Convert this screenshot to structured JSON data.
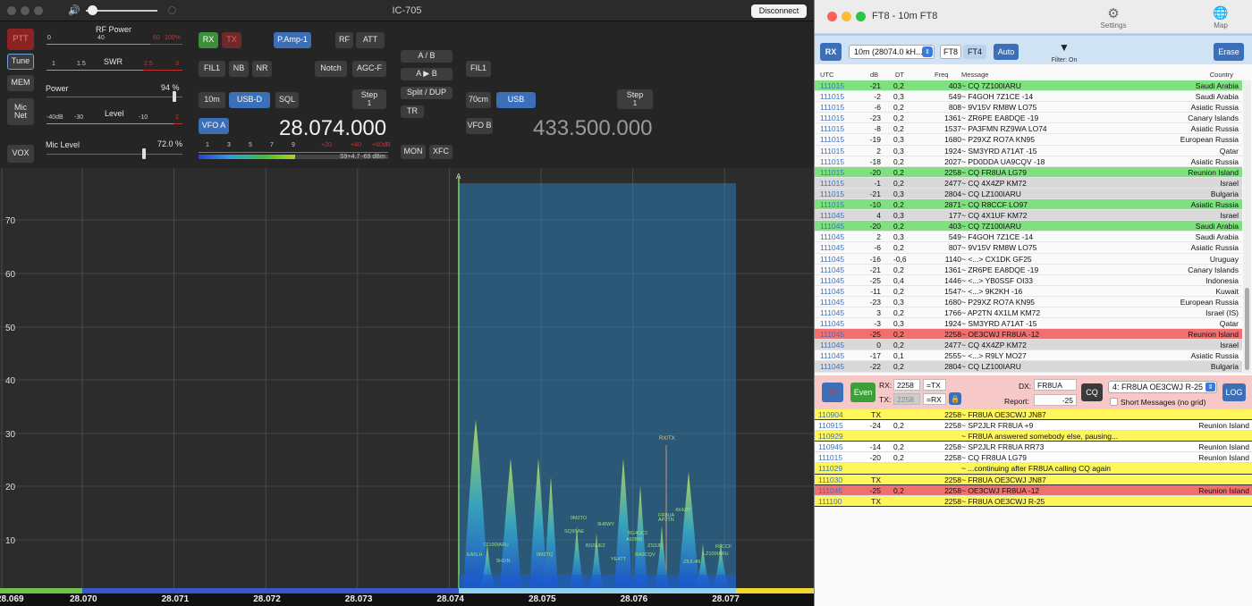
{
  "radio": {
    "title": "IC-705",
    "disconnect_label": "Disconnect",
    "left_buttons": {
      "ptt": "PTT",
      "tune": "Tune",
      "mem": "MEM",
      "mic_net": "Mic\nNet",
      "vox": "VOX"
    },
    "rf_power": {
      "label": "RF Power",
      "ticks": [
        "0",
        "40",
        "60",
        "100%"
      ]
    },
    "swr": {
      "label": "SWR",
      "ticks": [
        "1",
        "1.5",
        "2.5",
        "3"
      ]
    },
    "power": {
      "label": "Power",
      "value": "94 %",
      "level": 0.94
    },
    "level": {
      "label": "Level",
      "ticks": [
        "-40dB",
        "-30",
        "-10",
        "2"
      ]
    },
    "mic_level": {
      "label": "Mic Level",
      "value": "72.0 %",
      "level": 0.72
    },
    "buttons": {
      "rx": "RX",
      "tx": "TX",
      "pamp": "P.Amp-1",
      "rf": "RF",
      "att": "ATT",
      "fil1_a": "FIL1",
      "nb": "NB",
      "nr": "NR",
      "notch": "Notch",
      "agc": "AGC-F",
      "band_a": "10m",
      "mode_a": "USB-D",
      "sql": "SQL",
      "step_a_label": "Step",
      "step_a_value": "1",
      "vfo_a": "VFO A",
      "a_b": "A / B",
      "a_to_b": "A ▶ B",
      "split": "Split / DUP",
      "tr": "TR",
      "mon": "MON",
      "xfc": "XFC",
      "fil1_b": "FIL1",
      "band_b": "70cm",
      "mode_b": "USB",
      "step_b_label": "Step",
      "step_b_value": "1",
      "vfo_b": "VFO B"
    },
    "freq_a": "28.074.000",
    "freq_b": "433.500.000",
    "smeter": {
      "ticks": [
        "1",
        "3",
        "5",
        "7",
        "9",
        "+20",
        "+40",
        "+60dB"
      ],
      "reading": "S9+4.7 -69 dBm"
    },
    "spectrum": {
      "y_ticks": [
        "70",
        "60",
        "50",
        "40",
        "30",
        "20",
        "10"
      ],
      "x_ticks": [
        "28.069",
        "28.070",
        "28.071",
        "28.072",
        "28.073",
        "28.074",
        "28.075",
        "28.076",
        "28.077"
      ],
      "marker": "A",
      "rxtx_label": "RX/TX",
      "callsigns": [
        "7Z100IARU",
        "4X4ZP",
        "9H1IN",
        "AP2TN",
        "FR8UA",
        "0M2TO",
        "9H8WY",
        "SQ9SAE",
        "BG4UC2",
        "A92BM",
        "BG5UE2",
        "ZS3JD",
        "RA9CQV",
        "YE4TT",
        "9M2TQ",
        "Z8JL4N",
        "R9CCF",
        "LZ100IARU",
        "EA5LH"
      ]
    }
  },
  "ft8": {
    "title": "FT8 - 10m FT8",
    "settings_label": "Settings",
    "map_label": "Map",
    "toolbar": {
      "rx": "RX",
      "band": "10m (28074.0 kH...",
      "ft8": "FT8",
      "ft4": "FT4",
      "auto": "Auto",
      "filter": "Filter: On",
      "erase": "Erase"
    },
    "headers": {
      "utc": "UTC",
      "db": "dB",
      "dt": "DT",
      "freq": "Freq",
      "message": "Message",
      "country": "Country"
    },
    "rows": [
      {
        "utc": "111015",
        "db": "-21",
        "dt": "0,2",
        "freq": "403",
        "msg": "~ CQ 7Z100IARU",
        "cty": "Saudi Arabia",
        "hl": "green"
      },
      {
        "utc": "111015",
        "db": "-2",
        "dt": "0,3",
        "freq": "549",
        "msg": "~ F4GOH 7Z1CE -14",
        "cty": "Saudi Arabia",
        "hl": ""
      },
      {
        "utc": "111015",
        "db": "-6",
        "dt": "0,2",
        "freq": "808",
        "msg": "~ 9V15V RM8W LO75",
        "cty": "Asiatic Russia",
        "hl": ""
      },
      {
        "utc": "111015",
        "db": "-23",
        "dt": "0,2",
        "freq": "1361",
        "msg": "~ ZR6PE EA8DQE -19",
        "cty": "Canary Islands",
        "hl": ""
      },
      {
        "utc": "111015",
        "db": "-8",
        "dt": "0,2",
        "freq": "1537",
        "msg": "~ PA3FMN RZ9WA LO74",
        "cty": "Asiatic Russia",
        "hl": ""
      },
      {
        "utc": "111015",
        "db": "-19",
        "dt": "0,3",
        "freq": "1680",
        "msg": "~ P29XZ RO7A KN95",
        "cty": "European Russia",
        "hl": ""
      },
      {
        "utc": "111015",
        "db": "2",
        "dt": "0,3",
        "freq": "1924",
        "msg": "~ SM3YRD A71AT -15",
        "cty": "Qatar",
        "hl": ""
      },
      {
        "utc": "111015",
        "db": "-18",
        "dt": "0,2",
        "freq": "2027",
        "msg": "~ PD0DDA UA9CQV -18",
        "cty": "Asiatic Russia",
        "hl": ""
      },
      {
        "utc": "111015",
        "db": "-20",
        "dt": "0,2",
        "freq": "2258",
        "msg": "~ CQ FR8UA LG79",
        "cty": "Reunion Island",
        "hl": "green"
      },
      {
        "utc": "111015",
        "db": "-1",
        "dt": "0,2",
        "freq": "2477",
        "msg": "~ CQ 4X4ZP KM72",
        "cty": "Israel",
        "hl": "gray"
      },
      {
        "utc": "111015",
        "db": "-21",
        "dt": "0,3",
        "freq": "2804",
        "msg": "~ CQ LZ100IARU",
        "cty": "Bulgaria",
        "hl": "gray"
      },
      {
        "utc": "111015",
        "db": "-10",
        "dt": "0,2",
        "freq": "2871",
        "msg": "~ CQ R8CCF LO97",
        "cty": "Asiatic Russia",
        "hl": "green"
      },
      {
        "utc": "111045",
        "db": "4",
        "dt": "0,3",
        "freq": "177",
        "msg": "~ CQ 4X1UF KM72",
        "cty": "Israel",
        "hl": "gray"
      },
      {
        "utc": "111045",
        "db": "-20",
        "dt": "0,2",
        "freq": "403",
        "msg": "~ CQ 7Z100IARU",
        "cty": "Saudi Arabia",
        "hl": "green"
      },
      {
        "utc": "111045",
        "db": "2",
        "dt": "0,3",
        "freq": "549",
        "msg": "~ F4GOH 7Z1CE -14",
        "cty": "Saudi Arabia",
        "hl": ""
      },
      {
        "utc": "111045",
        "db": "-6",
        "dt": "0,2",
        "freq": "807",
        "msg": "~ 9V15V RM8W LO75",
        "cty": "Asiatic Russia",
        "hl": ""
      },
      {
        "utc": "111045",
        "db": "-16",
        "dt": "-0,6",
        "freq": "1140",
        "msg": "~ <...> CX1DK GF25",
        "cty": "Uruguay",
        "hl": ""
      },
      {
        "utc": "111045",
        "db": "-21",
        "dt": "0,2",
        "freq": "1361",
        "msg": "~ ZR6PE EA8DQE -19",
        "cty": "Canary Islands",
        "hl": ""
      },
      {
        "utc": "111045",
        "db": "-25",
        "dt": "0,4",
        "freq": "1446",
        "msg": "~ <...> YB0SSF OI33",
        "cty": "Indonesia",
        "hl": ""
      },
      {
        "utc": "111045",
        "db": "-11",
        "dt": "0,2",
        "freq": "1547",
        "msg": "~ <...> 9K2KH -16",
        "cty": "Kuwait",
        "hl": ""
      },
      {
        "utc": "111045",
        "db": "-23",
        "dt": "0,3",
        "freq": "1680",
        "msg": "~ P29XZ RO7A KN95",
        "cty": "European Russia",
        "hl": ""
      },
      {
        "utc": "111045",
        "db": "3",
        "dt": "0,2",
        "freq": "1766",
        "msg": "~ AP2TN 4X1LM KM72",
        "cty": "Israel (IS)",
        "hl": ""
      },
      {
        "utc": "111045",
        "db": "-3",
        "dt": "0,3",
        "freq": "1924",
        "msg": "~ SM3YRD A71AT -15",
        "cty": "Qatar",
        "hl": ""
      },
      {
        "utc": "111045",
        "db": "-25",
        "dt": "0,2",
        "freq": "2258",
        "msg": "~ OE3CWJ FR8UA -12",
        "cty": "Reunion Island",
        "hl": "red"
      },
      {
        "utc": "111045",
        "db": "0",
        "dt": "0,2",
        "freq": "2477",
        "msg": "~ CQ 4X4ZP KM72",
        "cty": "Israel",
        "hl": "gray"
      },
      {
        "utc": "111045",
        "db": "-17",
        "dt": "0,1",
        "freq": "2555",
        "msg": "~ <...> R9LY MO27",
        "cty": "Asiatic Russia",
        "hl": ""
      },
      {
        "utc": "111045",
        "db": "-22",
        "dt": "0,2",
        "freq": "2804",
        "msg": "~ CQ LZ100IARU",
        "cty": "Bulgaria",
        "hl": "gray"
      }
    ],
    "control": {
      "tx_toggle": "TX",
      "even": "Even",
      "rx_label": "RX:",
      "rx_value": "2258",
      "eq_tx": "=TX",
      "tx_label": "TX:",
      "tx_value": "2258",
      "eq_rx": "=RX",
      "dx_label": "DX:",
      "dx_value": "FR8UA",
      "report_label": "Report:",
      "report_value": "-25",
      "cq": "CQ",
      "message_select": "4: FR8UA OE3CWJ R-25",
      "short_messages": "Short Messages (no grid)",
      "log": "LOG"
    },
    "log": [
      {
        "utc": "110904",
        "db": "TX",
        "dt": "",
        "freq": "2258",
        "msg": "~ FR8UA OE3CWJ JN87",
        "cty": "",
        "hl": "yellow"
      },
      {
        "utc": "110915",
        "db": "-24",
        "dt": "0,2",
        "freq": "2258",
        "msg": "~ SP2JLR FR8UA +9",
        "cty": "Reunion Island",
        "hl": "white"
      },
      {
        "utc": "110929",
        "db": "",
        "dt": "",
        "freq": "",
        "msg": "~ FR8UA answered somebody else, pausing...",
        "cty": "",
        "hl": "yellow"
      },
      {
        "utc": "110945",
        "db": "-14",
        "dt": "0,2",
        "freq": "2258",
        "msg": "~ SP2JLR FR8UA RR73",
        "cty": "Reunion Island",
        "hl": "white"
      },
      {
        "utc": "111015",
        "db": "-20",
        "dt": "0,2",
        "freq": "2258",
        "msg": "~ CQ FR8UA LG79",
        "cty": "Reunion Island",
        "hl": "white"
      },
      {
        "utc": "111029",
        "db": "",
        "dt": "",
        "freq": "",
        "msg": "~ ...continuing after FR8UA calling CQ again",
        "cty": "",
        "hl": "yellow"
      },
      {
        "utc": "111030",
        "db": "TX",
        "dt": "",
        "freq": "2258",
        "msg": "~ FR8UA OE3CWJ JN87",
        "cty": "",
        "hl": "yellow"
      },
      {
        "utc": "111045",
        "db": "-25",
        "dt": "0,2",
        "freq": "2258",
        "msg": "~ OE3CWJ FR8UA -12",
        "cty": "Reunion Island",
        "hl": "red"
      },
      {
        "utc": "111100",
        "db": "TX",
        "dt": "",
        "freq": "2258",
        "msg": "~ FR8UA OE3CWJ R-25",
        "cty": "",
        "hl": "yellow"
      }
    ]
  },
  "icons": {
    "volume": "speaker-icon",
    "settings": "gear-icon",
    "map": "globe-icon",
    "filter": "funnel-icon",
    "lock": "lock-icon"
  }
}
